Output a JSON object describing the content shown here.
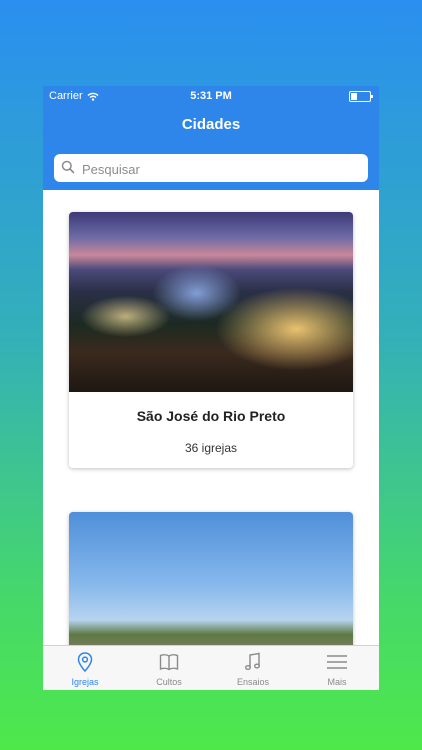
{
  "status_bar": {
    "carrier": "Carrier",
    "time": "5:31 PM"
  },
  "header": {
    "title": "Cidades"
  },
  "search": {
    "placeholder": "Pesquisar",
    "value": ""
  },
  "cities": [
    {
      "name": "São José do Rio Preto",
      "count": "36 igrejas"
    },
    {
      "name": "",
      "count": ""
    }
  ],
  "tabs": [
    {
      "label": "Igrejas",
      "icon": "map-pin-icon",
      "active": true
    },
    {
      "label": "Cultos",
      "icon": "book-icon",
      "active": false
    },
    {
      "label": "Ensaios",
      "icon": "music-note-icon",
      "active": false
    },
    {
      "label": "Mais",
      "icon": "menu-icon",
      "active": false
    }
  ],
  "colors": {
    "accent": "#2f86ea",
    "inactive": "#8a8a8a",
    "background_top": "#2a8ff0",
    "background_bottom": "#4fe84a"
  }
}
